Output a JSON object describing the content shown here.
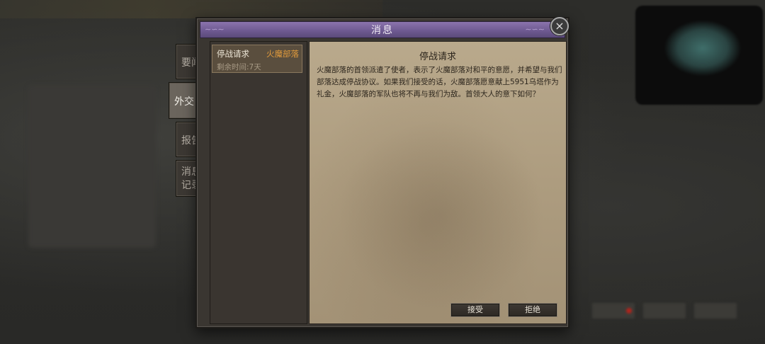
{
  "dialog": {
    "title": "消息",
    "close_icon": "×"
  },
  "tabs": [
    {
      "line1": "要闻",
      "line2": ""
    },
    {
      "line1": "外交",
      "line2": ""
    },
    {
      "line1": "报告",
      "line2": ""
    },
    {
      "line1": "消息",
      "line2": "记录"
    }
  ],
  "active_tab": "外交",
  "message_list": [
    {
      "title": "停战请求",
      "faction": "火魔部落",
      "time_left": "剩余时间:7天"
    }
  ],
  "detail": {
    "title": "停战请求",
    "body": "火魔部落的首领派遣了使者，表示了火魔部落对和平的意愿，并希望与我们部落达成停战协议。如果我们接受的话，火魔部落愿意献上5951乌塔作为礼金，火魔部落的军队也将不再与我们为敌。首领大人的意下如何？",
    "accept_label": "接受",
    "reject_label": "拒绝"
  },
  "colors": {
    "titlebar": "#6f5a92",
    "faction_highlight": "#e09a3c",
    "parchment": "#ad9c7f"
  }
}
